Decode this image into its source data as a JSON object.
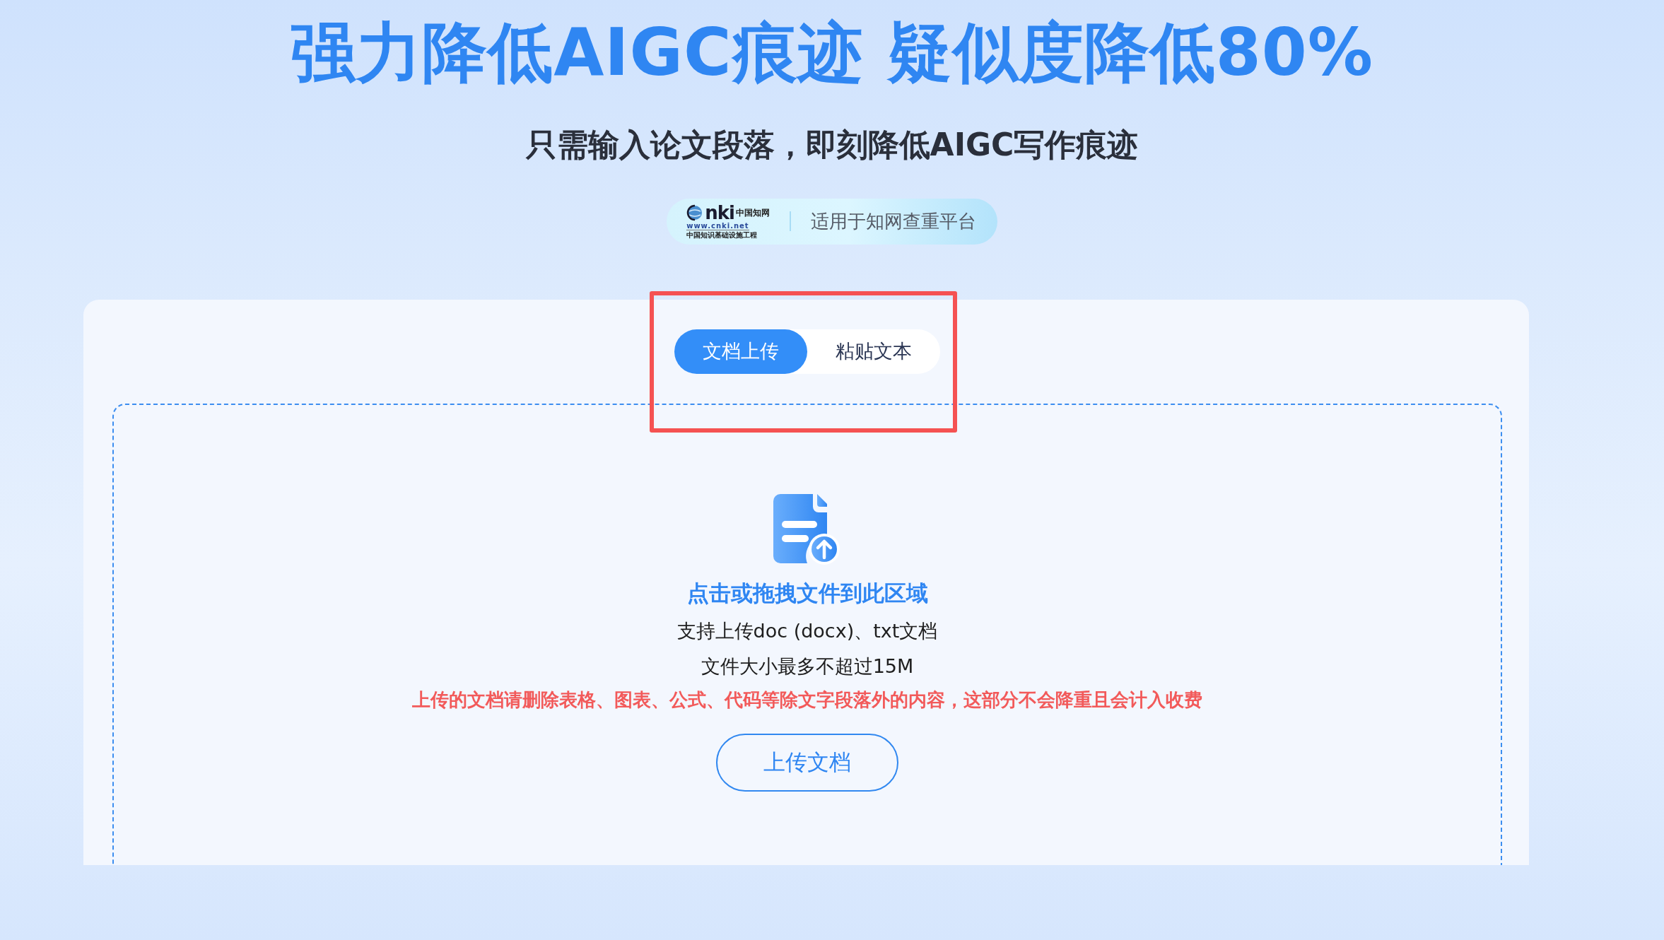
{
  "hero": {
    "title": "强力降低AIGC痕迹 疑似度降低80%",
    "subtitle": "只需输入论文段落，即刻降低AIGC写作痕迹"
  },
  "badge": {
    "logo": {
      "mark": "nki",
      "name": "中国知网",
      "url": "www.cnki.net",
      "tagline": "中国知识基础设施工程"
    },
    "text": "适用于知网查重平台"
  },
  "tabs": [
    {
      "label": "文档上传",
      "selected": true
    },
    {
      "label": "粘贴文本",
      "selected": false
    }
  ],
  "tabs_highlighted": true,
  "upload": {
    "prompt": "点击或拖拽文件到此区域",
    "formats": "支持上传doc (docx)、txt文档",
    "size_limit": "文件大小最多不超过15M",
    "warning": "上传的文档请删除表格、图表、公式、代码等除文字段落外的内容，这部分不会降重且会计入收费",
    "button": "上传文档"
  }
}
